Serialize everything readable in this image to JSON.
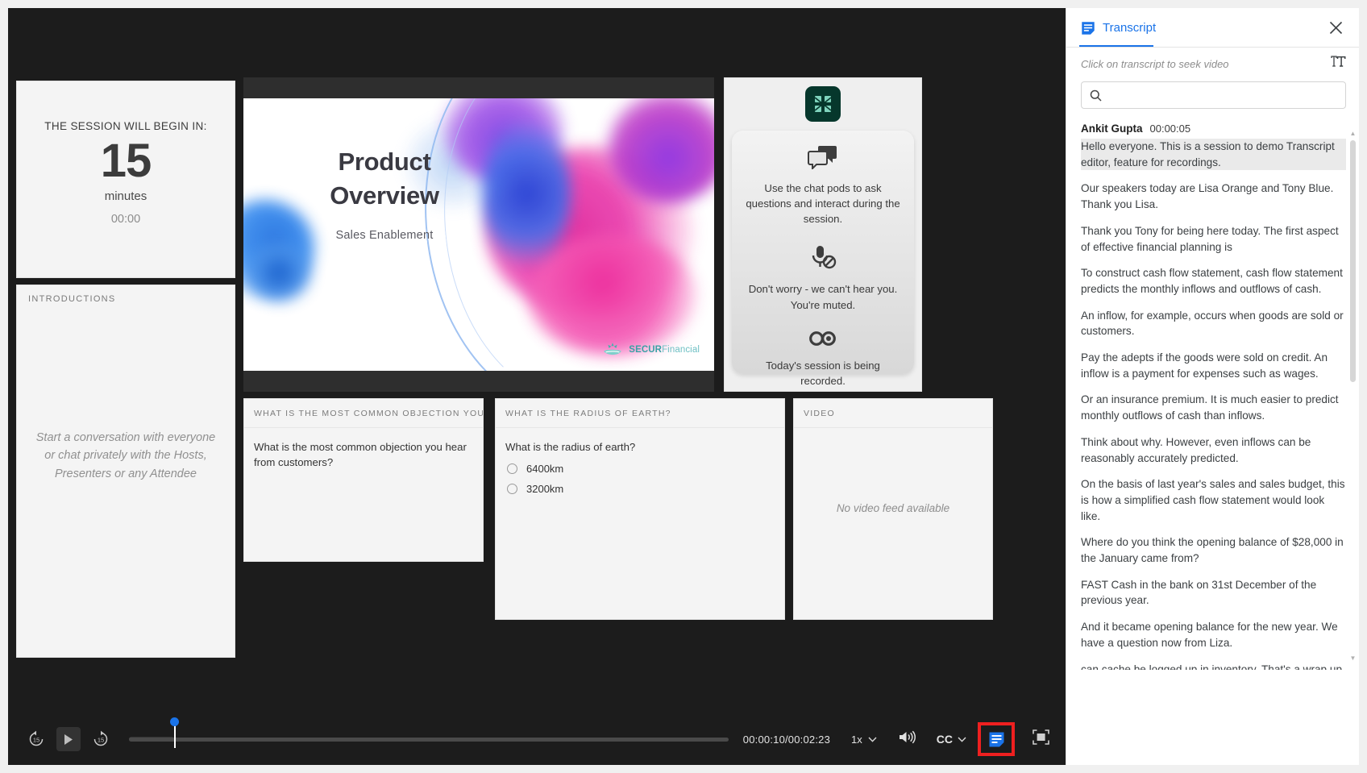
{
  "countdown": {
    "label": "THE SESSION WILL BEGIN IN:",
    "number": "15",
    "unit": "minutes",
    "clock": "00:00"
  },
  "chat": {
    "title": "INTRODUCTIONS",
    "empty_text": "Start a conversation with everyone or chat privately with the Hosts, Presenters or any Attendee"
  },
  "slide": {
    "title_line1": "Product",
    "title_line2": "Overview",
    "subtitle": "Sales Enablement",
    "logo_bold": "SECUR",
    "logo_light": "Financial"
  },
  "info": {
    "blocks": [
      {
        "icon": "chat-bubbles-icon",
        "text": "Use the chat pods to ask questions and interact during the session."
      },
      {
        "icon": "microphone-muted-icon",
        "text": "Don't worry - we can't hear you. You're muted."
      },
      {
        "icon": "recording-icon",
        "text": "Today's session is being recorded."
      }
    ]
  },
  "poll1": {
    "header": "WHAT IS THE MOST COMMON OBJECTION YOU HEAR F...",
    "question": "What is the most common objection you hear from customers?"
  },
  "poll2": {
    "header": "WHAT IS THE RADIUS OF EARTH?",
    "question": "What is the radius of earth?",
    "options": [
      "6400km",
      "3200km"
    ]
  },
  "video": {
    "header": "VIDEO",
    "empty_text": "No video feed available"
  },
  "controls": {
    "rewind_label": "15",
    "forward_label": "15",
    "play_icon": "play-icon",
    "time": "00:00:10/00:02:23",
    "speed": "1x",
    "cc": "CC",
    "progress_percent": 7.5
  },
  "transcript": {
    "tab_label": "Transcript",
    "hint": "Click on transcript to seek video",
    "search_value": "",
    "search_placeholder": "",
    "speaker": "Ankit Gupta",
    "timestamp": "00:00:05",
    "cues": [
      {
        "text": "Hello everyone. This is a session to demo Transcript editor, feature for recordings.",
        "active": true
      },
      {
        "text": "Our speakers today are Lisa Orange and Tony Blue. Thank you Lisa.",
        "active": false
      },
      {
        "text": "Thank you Tony for being here today. The first aspect of effective financial planning is",
        "active": false
      },
      {
        "text": "To construct cash flow statement, cash flow statement predicts the monthly inflows and outflows of cash.",
        "active": false
      },
      {
        "text": "An inflow, for example, occurs when goods are sold or customers.",
        "active": false
      },
      {
        "text": "Pay the adepts if the goods were sold on credit. An inflow is a payment for expenses such as wages.",
        "active": false
      },
      {
        "text": "Or an insurance premium. It is much easier to predict monthly outflows of cash than inflows.",
        "active": false
      },
      {
        "text": "Think about why. However, even inflows can be reasonably accurately predicted.",
        "active": false
      },
      {
        "text": "On the basis of last year's sales and sales budget, this is how a simplified cash flow statement would look like.",
        "active": false
      },
      {
        "text": "Where do you think the opening balance of $28,000 in the January came from?",
        "active": false
      },
      {
        "text": "FAST Cash in the bank on 31st December of the previous year.",
        "active": false
      },
      {
        "text": "And it became opening balance for the new year. We have a question now from Liza.",
        "active": false
      },
      {
        "text": "can cache be logged up in inventory. That's a wrap up on the session. We have a a note spot here.",
        "active": false
      }
    ]
  },
  "colors": {
    "accent": "#1a73e8",
    "player_bg": "#1c1c1c",
    "highlight_box": "#ef2020",
    "brand_teal": "#3aa0a5"
  }
}
